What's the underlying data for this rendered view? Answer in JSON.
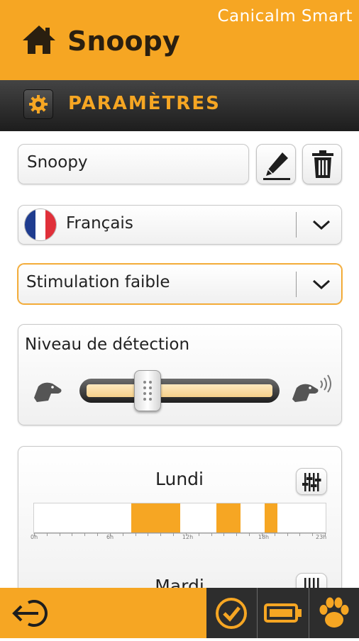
{
  "header": {
    "brand": "Canicalm Smart",
    "dog_name": "Snoopy"
  },
  "section": {
    "title": "PARAMÈTRES",
    "icon": "gear-icon"
  },
  "form": {
    "name_value": "Snoopy",
    "language": {
      "selected": "Français",
      "flag": "france-flag"
    },
    "stimulation": {
      "selected": "Stimulation faible"
    },
    "detection": {
      "label": "Niveau de détection",
      "level_percent": 33
    }
  },
  "schedule": {
    "hour_labels": [
      "0h",
      "6h",
      "12h",
      "18h",
      "23h"
    ],
    "days": [
      {
        "name": "Lundi",
        "active_ranges_h": [
          [
            8,
            12
          ],
          [
            15,
            17
          ],
          [
            19,
            20
          ]
        ]
      },
      {
        "name": "Mardi"
      }
    ]
  },
  "colors": {
    "accent": "#f6a623",
    "dark": "#2d2d2d",
    "slider_fill": "#f6d08a"
  },
  "bottom_bar": {
    "icons": [
      "logout-icon",
      "check-icon",
      "battery-icon",
      "paw-icon"
    ]
  }
}
